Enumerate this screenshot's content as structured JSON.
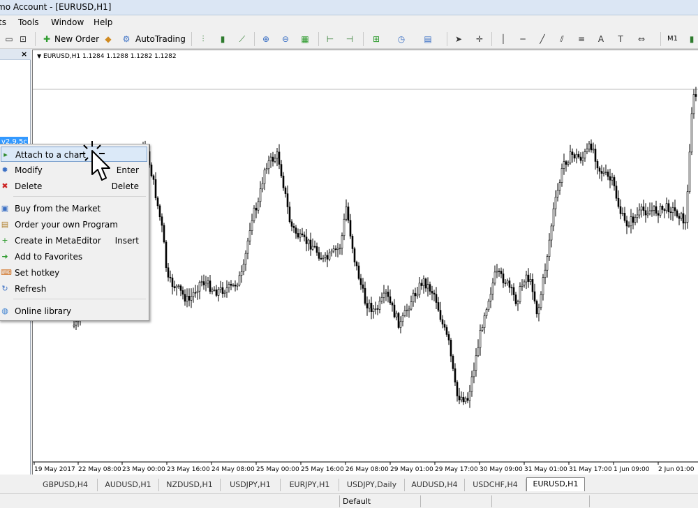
{
  "window": {
    "title": "mo Account - [EURUSD,H1]"
  },
  "menu": [
    "ts",
    "Tools",
    "Window",
    "Help"
  ],
  "toolbar": {
    "new_order": "New Order",
    "autotrading": "AutoTrading",
    "timeframe": "M1"
  },
  "navigator": {
    "close": "×",
    "selected_item": "v2.9.5c"
  },
  "chart": {
    "header": "EURUSD,H1  1.1284 1.1288 1.1282 1.1282",
    "xticks": [
      "19 May 2017",
      "22 May 08:00",
      "23 May 00:00",
      "23 May 16:00",
      "24 May 08:00",
      "25 May 00:00",
      "25 May 16:00",
      "26 May 08:00",
      "29 May 01:00",
      "29 May 17:00",
      "30 May 09:00",
      "31 May 01:00",
      "31 May 17:00",
      "1 Jun 09:00",
      "2 Jun 01:00"
    ]
  },
  "context_menu": {
    "items": [
      {
        "label": "Attach to a chart",
        "shortcut": "",
        "icon": "attach-icon",
        "color": "#2e8b2e",
        "glyph": "▸"
      },
      {
        "label": "Modify",
        "shortcut": "Enter",
        "icon": "gear-icon",
        "color": "#3a6fc4",
        "glyph": "✹"
      },
      {
        "label": "Delete",
        "shortcut": "Delete",
        "icon": "delete-icon",
        "color": "#cc2222",
        "glyph": "✖"
      },
      {
        "label": "Buy from the Market",
        "shortcut": "",
        "icon": "market-icon",
        "color": "#3a6fc4",
        "glyph": "▣"
      },
      {
        "label": "Order your own Program",
        "shortcut": "",
        "icon": "order-icon",
        "color": "#b0802e",
        "glyph": "▤"
      },
      {
        "label": "Create in MetaEditor",
        "shortcut": "Insert",
        "icon": "plus-icon",
        "color": "#2e9b2e",
        "glyph": "+"
      },
      {
        "label": "Add to Favorites",
        "shortcut": "",
        "icon": "favorites-icon",
        "color": "#2e9b2e",
        "glyph": "➜"
      },
      {
        "label": "Set hotkey",
        "shortcut": "",
        "icon": "hotkey-icon",
        "color": "#d07020",
        "glyph": "⌨"
      },
      {
        "label": "Refresh",
        "shortcut": "",
        "icon": "refresh-icon",
        "color": "#3a6fc4",
        "glyph": "↻"
      },
      {
        "label": "Online library",
        "shortcut": "",
        "icon": "globe-icon",
        "color": "#3a7fd0",
        "glyph": "◍"
      }
    ]
  },
  "tabs": [
    "GBPUSD,H4",
    "AUDUSD,H1",
    "NZDUSD,H1",
    "USDJPY,H1",
    "EURJPY,H1",
    "USDJPY,Daily",
    "AUDUSD,H4",
    "USDCHF,H4",
    "EURUSD,H1"
  ],
  "active_tab": "EURUSD,H1",
  "status": {
    "profile": "Default"
  },
  "chart_data": {
    "type": "candlestick",
    "symbol": "EURUSD",
    "timeframe": "H1",
    "ohlc_last": [
      1.1284,
      1.1288,
      1.1282,
      1.1282
    ]
  }
}
